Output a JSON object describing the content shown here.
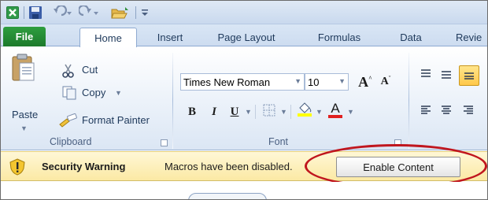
{
  "tabs": [
    "File",
    "Home",
    "Insert",
    "Page Layout",
    "Formulas",
    "Data",
    "Revie"
  ],
  "clipboard": {
    "paste": "Paste",
    "cut": "Cut",
    "copy": "Copy",
    "format_painter": "Format Painter",
    "label": "Clipboard"
  },
  "font": {
    "name": "Times New Roman",
    "size": "10",
    "bold": "B",
    "italic": "I",
    "underline": "U",
    "grow": "A",
    "shrink": "A",
    "color": "A",
    "label": "Font"
  },
  "security": {
    "title": "Security Warning",
    "message": "Macros have been disabled.",
    "button": "Enable Content"
  },
  "colors": {
    "file_tab": "#1d7a2c",
    "warning_bar": "#fbe9a4",
    "annotation": "#c0161e"
  }
}
